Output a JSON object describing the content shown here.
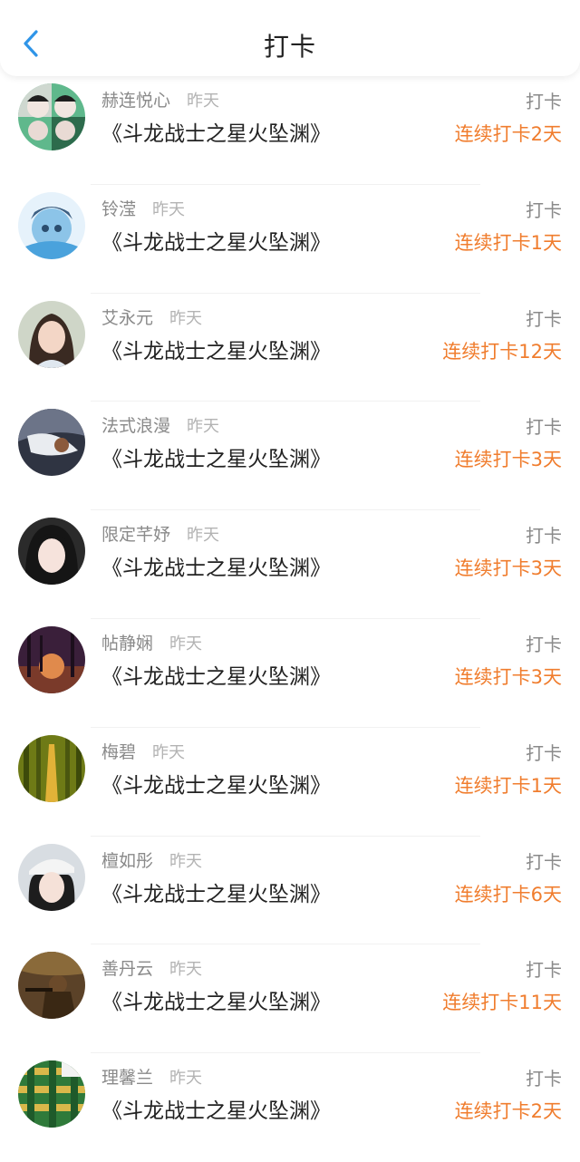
{
  "header": {
    "title": "打卡"
  },
  "icons": {
    "back": "chevron-left-icon"
  },
  "colors": {
    "accent": "#f07d2e",
    "back_icon": "#2f95e8"
  },
  "entries": [
    {
      "name": "赫连悦心",
      "time": "昨天",
      "book": "《斗龙战士之星火坠渊》",
      "action": "打卡",
      "streak": "连续打卡2天"
    },
    {
      "name": "铃滢",
      "time": "昨天",
      "book": "《斗龙战士之星火坠渊》",
      "action": "打卡",
      "streak": "连续打卡1天"
    },
    {
      "name": "艾永元",
      "time": "昨天",
      "book": "《斗龙战士之星火坠渊》",
      "action": "打卡",
      "streak": "连续打卡12天"
    },
    {
      "name": "法式浪漫",
      "time": "昨天",
      "book": "《斗龙战士之星火坠渊》",
      "action": "打卡",
      "streak": "连续打卡3天"
    },
    {
      "name": "限定芊妤",
      "time": "昨天",
      "book": "《斗龙战士之星火坠渊》",
      "action": "打卡",
      "streak": "连续打卡3天"
    },
    {
      "name": "帖静娴",
      "time": "昨天",
      "book": "《斗龙战士之星火坠渊》",
      "action": "打卡",
      "streak": "连续打卡3天"
    },
    {
      "name": "梅碧",
      "time": "昨天",
      "book": "《斗龙战士之星火坠渊》",
      "action": "打卡",
      "streak": "连续打卡1天"
    },
    {
      "name": "檀如彤",
      "time": "昨天",
      "book": "《斗龙战士之星火坠渊》",
      "action": "打卡",
      "streak": "连续打卡6天"
    },
    {
      "name": "善丹云",
      "time": "昨天",
      "book": "《斗龙战士之星火坠渊》",
      "action": "打卡",
      "streak": "连续打卡11天"
    },
    {
      "name": "理馨兰",
      "time": "昨天",
      "book": "《斗龙战士之星火坠渊》",
      "action": "打卡",
      "streak": "连续打卡2天"
    }
  ]
}
